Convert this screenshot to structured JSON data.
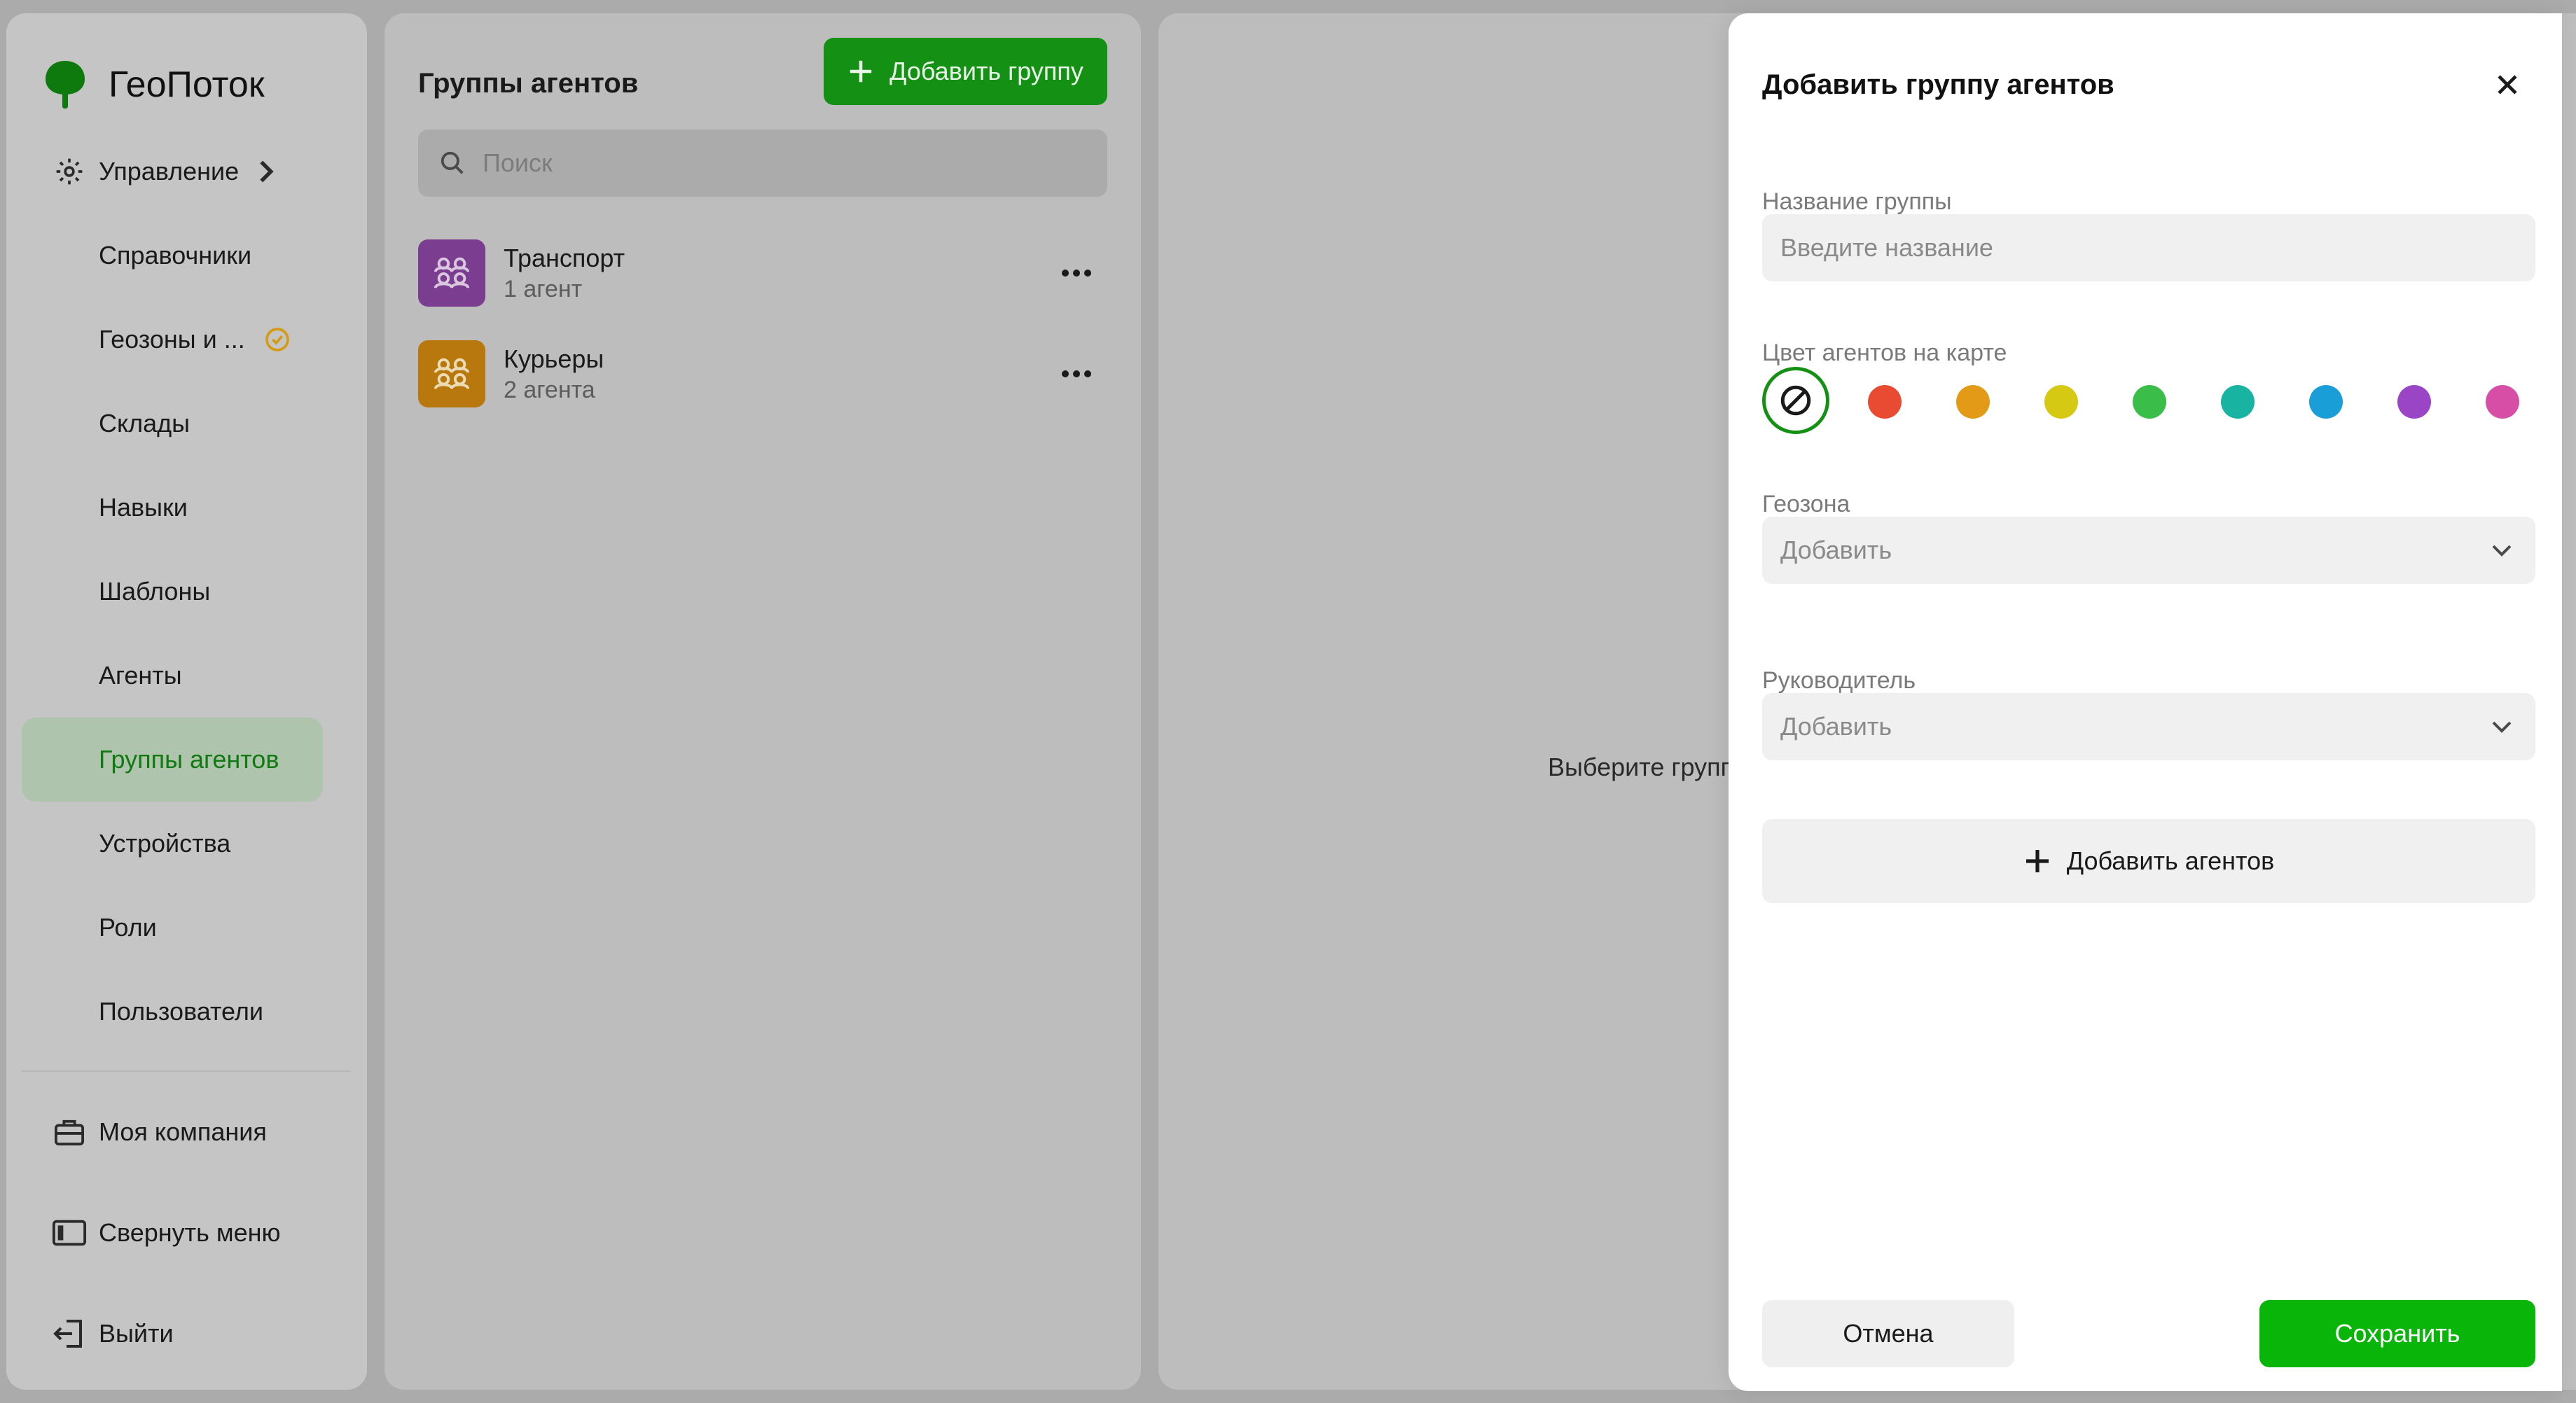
{
  "app": {
    "name": "ГеоПоток"
  },
  "sidebar": {
    "items": [
      {
        "label": "Управление",
        "icon": "gear-icon"
      },
      {
        "label": "Справочники"
      },
      {
        "label": "Геозоны и ...",
        "badge_icon": "clock-badge-icon"
      },
      {
        "label": "Склады"
      },
      {
        "label": "Навыки"
      },
      {
        "label": "Шаблоны"
      },
      {
        "label": "Агенты"
      },
      {
        "label": "Группы агентов",
        "active": true
      },
      {
        "label": "Устройства"
      },
      {
        "label": "Роли"
      },
      {
        "label": "Пользователи"
      }
    ],
    "bottom": [
      {
        "label": "Моя компания",
        "icon": "briefcase-icon"
      },
      {
        "label": "Свернуть меню",
        "icon": "collapse-icon"
      },
      {
        "label": "Выйти",
        "icon": "logout-icon"
      }
    ]
  },
  "groups": {
    "title": "Группы агентов",
    "add_button": "Добавить группу",
    "search_placeholder": "Поиск",
    "list": [
      {
        "name": "Транспорт",
        "count": "1 агент",
        "color": "#7b3d8f"
      },
      {
        "name": "Курьеры",
        "count": "2 агента",
        "color": "#b9780e"
      }
    ]
  },
  "detail": {
    "hint": "Выберите групп"
  },
  "modal": {
    "title": "Добавить группу агентов",
    "name_label": "Название группы",
    "name_placeholder": "Введите название",
    "color_label": "Цвет агентов на карте",
    "colors": [
      "none",
      "#e84a32",
      "#e39a16",
      "#d6c914",
      "#3bbd4a",
      "#18b3a1",
      "#1a9ed8",
      "#9a45c6",
      "#d64ea6"
    ],
    "geozone_label": "Геозона",
    "geozone_value": "Добавить",
    "manager_label": "Руководитель",
    "manager_value": "Добавить",
    "add_agents": "Добавить агентов",
    "cancel": "Отмена",
    "save": "Сохранить"
  },
  "colors": {
    "accent": "#149114",
    "save": "#09b509"
  }
}
